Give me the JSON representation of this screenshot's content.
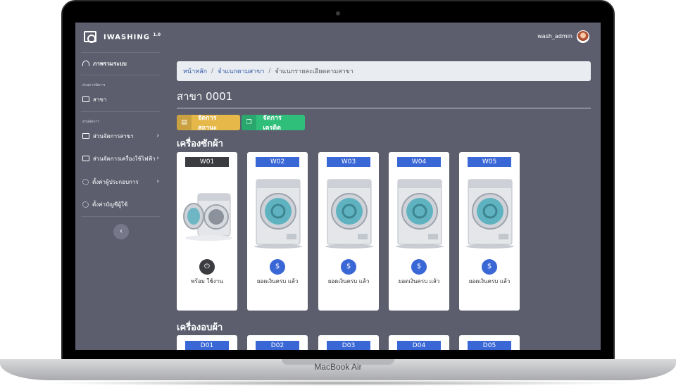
{
  "device": {
    "label": "MacBook Air"
  },
  "brand": {
    "name": "IWASHING",
    "version": "1.0"
  },
  "user": {
    "name": "wash_admin"
  },
  "sidebar": {
    "overview": "ภาพรวมระบบ",
    "section_branch": "ส่วนการจัดการ",
    "branch": "สาขา",
    "section_manage": "ส่วนจัดการ",
    "items": [
      {
        "label": "ส่วนจัดการสาขา"
      },
      {
        "label": "ส่วนจัดการเครื่องใช้ไฟฟ้า"
      },
      {
        "label": "ตั้งค่าผู้ประกอบการ"
      },
      {
        "label": "ตั้งค่าบัญชีผู้ใช้"
      }
    ],
    "collapse_icon": "‹"
  },
  "breadcrumb": {
    "home": "หน้าหลัก",
    "branches": "จำแนกตามสาขา",
    "current": "จำแนกรายละเอียดตามสาขา",
    "sep": "/"
  },
  "page": {
    "title": "สาขา 0001"
  },
  "actions": {
    "status_label": "จัดการสถานะ",
    "credit_label": "จัดการเครดิต"
  },
  "washers": {
    "title": "เครื่องซักผ้า",
    "items": [
      {
        "id": "W01",
        "status": "พร้อม ใช้งาน",
        "status_icon": "power-icon"
      },
      {
        "id": "W02",
        "status": "ยอดเงินครบ แล้ว",
        "status_icon": "coin-hand-icon"
      },
      {
        "id": "W03",
        "status": "ยอดเงินครบ แล้ว",
        "status_icon": "coin-hand-icon"
      },
      {
        "id": "W04",
        "status": "ยอดเงินครบ แล้ว",
        "status_icon": "coin-hand-icon"
      },
      {
        "id": "W05",
        "status": "ยอดเงินครบ แล้ว",
        "status_icon": "coin-hand-icon"
      }
    ]
  },
  "dryers": {
    "title": "เครื่องอบผ้า",
    "items": [
      {
        "id": "D01"
      },
      {
        "id": "D02"
      },
      {
        "id": "D03"
      },
      {
        "id": "D04"
      },
      {
        "id": "D05"
      }
    ]
  }
}
